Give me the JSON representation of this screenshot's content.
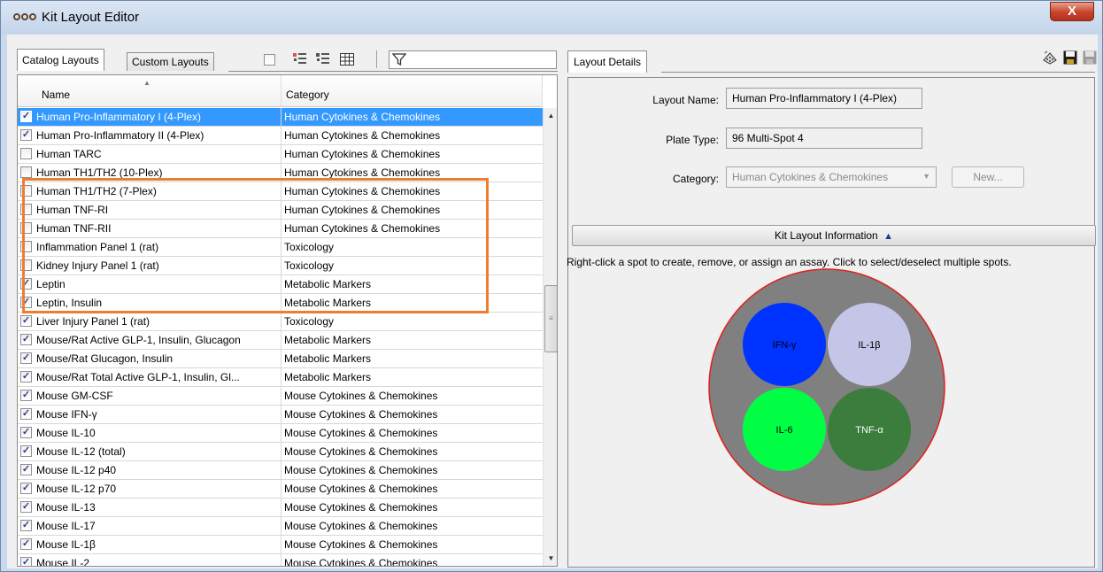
{
  "window": {
    "title": "Kit Layout Editor",
    "close_label": "X"
  },
  "left": {
    "tabs": [
      {
        "label": "Catalog Layouts"
      },
      {
        "label": "Custom Layouts"
      }
    ],
    "columns": {
      "name": "Name",
      "category": "Category"
    },
    "rows": [
      {
        "name": "Human Pro-Inflammatory I (4-Plex)",
        "category": "Human Cytokines & Chemokines",
        "checked": true,
        "selected": true
      },
      {
        "name": "Human Pro-Inflammatory II (4-Plex)",
        "category": "Human Cytokines & Chemokines",
        "checked": true
      },
      {
        "name": "Human TARC",
        "category": "Human Cytokines & Chemokines",
        "checked": false
      },
      {
        "name": "Human TH1/TH2 (10-Plex)",
        "category": "Human Cytokines & Chemokines",
        "checked": false
      },
      {
        "name": "Human TH1/TH2 (7-Plex)",
        "category": "Human Cytokines & Chemokines",
        "checked": false
      },
      {
        "name": "Human TNF-RI",
        "category": "Human Cytokines & Chemokines",
        "checked": false
      },
      {
        "name": "Human TNF-RII",
        "category": "Human Cytokines & Chemokines",
        "checked": false
      },
      {
        "name": "Inflammation Panel 1 (rat)",
        "category": "Toxicology",
        "checked": false
      },
      {
        "name": "Kidney Injury Panel 1 (rat)",
        "category": "Toxicology",
        "checked": false
      },
      {
        "name": "Leptin",
        "category": "Metabolic Markers",
        "checked": true
      },
      {
        "name": "Leptin, Insulin",
        "category": "Metabolic Markers",
        "checked": true
      },
      {
        "name": "Liver Injury Panel 1 (rat)",
        "category": "Toxicology",
        "checked": true
      },
      {
        "name": "Mouse/Rat Active GLP-1, Insulin, Glucagon",
        "category": "Metabolic Markers",
        "checked": true
      },
      {
        "name": "Mouse/Rat Glucagon, Insulin",
        "category": "Metabolic Markers",
        "checked": true
      },
      {
        "name": "Mouse/Rat Total Active GLP-1, Insulin, Gl...",
        "category": "Metabolic Markers",
        "checked": true
      },
      {
        "name": "Mouse GM-CSF",
        "category": "Mouse Cytokines & Chemokines",
        "checked": true
      },
      {
        "name": "Mouse IFN-γ",
        "category": "Mouse Cytokines & Chemokines",
        "checked": true
      },
      {
        "name": "Mouse IL-10",
        "category": "Mouse Cytokines & Chemokines",
        "checked": true
      },
      {
        "name": "Mouse IL-12 (total)",
        "category": "Mouse Cytokines & Chemokines",
        "checked": true
      },
      {
        "name": "Mouse IL-12 p40",
        "category": "Mouse Cytokines & Chemokines",
        "checked": true
      },
      {
        "name": "Mouse IL-12 p70",
        "category": "Mouse Cytokines & Chemokines",
        "checked": true
      },
      {
        "name": "Mouse IL-13",
        "category": "Mouse Cytokines & Chemokines",
        "checked": true
      },
      {
        "name": "Mouse IL-17",
        "category": "Mouse Cytokines & Chemokines",
        "checked": true
      },
      {
        "name": "Mouse IL-1β",
        "category": "Mouse Cytokines & Chemokines",
        "checked": true
      },
      {
        "name": "Mouse IL-2",
        "category": "Mouse Cytokines & Chemokines",
        "checked": true
      }
    ]
  },
  "right": {
    "tab_label": "Layout Details",
    "layout_name_label": "Layout Name:",
    "layout_name_value": "Human Pro-Inflammatory I (4-Plex)",
    "plate_type_label": "Plate Type:",
    "plate_type_value": "96 Multi-Spot 4",
    "category_label": "Category:",
    "category_value": "Human Cytokines & Chemokines",
    "new_button_label": "New...",
    "kit_info_label": "Kit Layout Information",
    "instructions": "Right-click a spot to create, remove, or assign an assay. Click to select/deselect multiple spots.",
    "spots": [
      {
        "label": "IFN-γ",
        "color": "#0033ff"
      },
      {
        "label": "IL-1β",
        "color": "#c5c5e8"
      },
      {
        "label": "IL-6",
        "color": "#00ff44"
      },
      {
        "label": "TNF-α",
        "color": "#3a7d3c"
      }
    ],
    "well_color": "#808080",
    "well_border_color": "#e0201a"
  },
  "colors": {
    "selection": "#3399ff",
    "highlight_box": "#ed7d31"
  }
}
